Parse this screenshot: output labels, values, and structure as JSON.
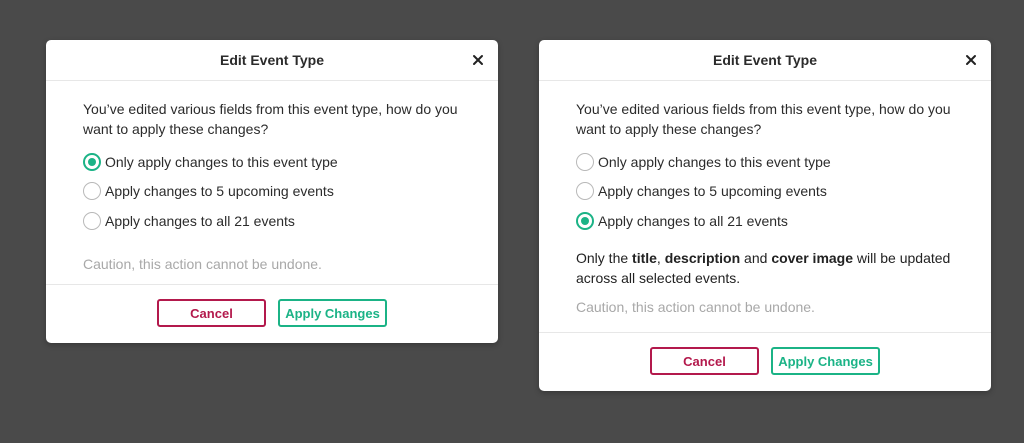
{
  "dialogs": [
    {
      "title": "Edit Event Type",
      "question": "You’ve edited various fields from this event type, how do you want to apply these changes?",
      "options": [
        {
          "label": "Only apply changes to this event type",
          "checked": true
        },
        {
          "label": "Apply changes to 5 upcoming events",
          "checked": false
        },
        {
          "label": "Apply changes to all 21 events",
          "checked": false
        }
      ],
      "caution": "Caution, this action cannot be undone.",
      "cancel_label": "Cancel",
      "apply_label": "Apply Changes"
    },
    {
      "title": "Edit Event Type",
      "question": "You’ve edited various fields from this event type, how do you want to apply these changes?",
      "options": [
        {
          "label": "Only apply changes to this event type",
          "checked": false
        },
        {
          "label": "Apply changes to 5 upcoming events",
          "checked": false
        },
        {
          "label": "Apply changes to all 21 events",
          "checked": true
        }
      ],
      "note": {
        "part1": "Only the ",
        "title_word": "title",
        "part2": ", ",
        "description_word": "description",
        "part3": " and ",
        "cover_word": "cover image",
        "part4": " will be updated across all selected events."
      },
      "caution": "Caution, this action cannot be undone.",
      "cancel_label": "Cancel",
      "apply_label": "Apply Changes"
    }
  ],
  "colors": {
    "backdrop": "#4a4a4a",
    "accent_green": "#1bb386",
    "cancel_red": "#b3194c",
    "caution_gray": "#a8a8a8"
  },
  "icons": {
    "close": "close-icon"
  }
}
